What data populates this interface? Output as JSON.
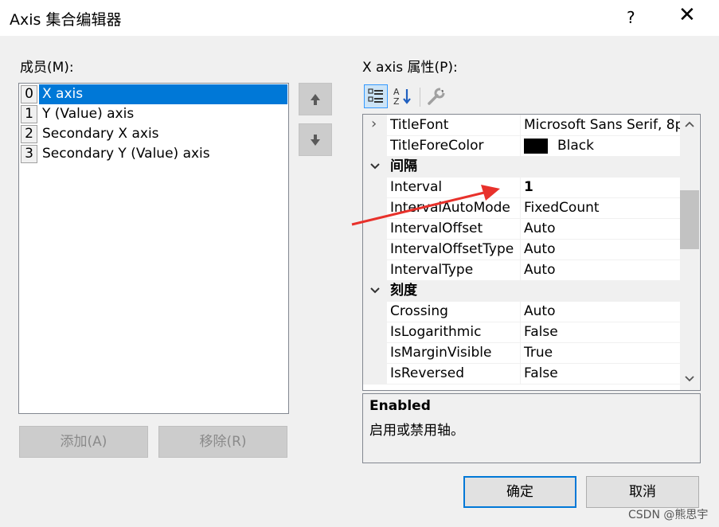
{
  "window": {
    "title": "Axis 集合编辑器",
    "help": "?",
    "close": "✕"
  },
  "members": {
    "label": "成员(M):",
    "items": [
      {
        "index": "0",
        "name": "X axis"
      },
      {
        "index": "1",
        "name": "Y (Value) axis"
      },
      {
        "index": "2",
        "name": "Secondary X axis"
      },
      {
        "index": "3",
        "name": "Secondary Y (Value) axis"
      }
    ],
    "selected_index": 0,
    "add_label": "添加(A)",
    "remove_label": "移除(R)"
  },
  "properties": {
    "label": "X axis 属性(P):",
    "rows": [
      {
        "kind": "prop",
        "expander": "›",
        "name": "TitleFont",
        "value": "Microsoft Sans Serif, 8p"
      },
      {
        "kind": "prop",
        "name": "TitleForeColor",
        "value": "Black",
        "swatch": "#000000"
      },
      {
        "kind": "cat",
        "name": "间隔"
      },
      {
        "kind": "prop",
        "name": "Interval",
        "value": "1",
        "bold": true
      },
      {
        "kind": "prop",
        "name": "IntervalAutoMode",
        "value": "FixedCount"
      },
      {
        "kind": "prop",
        "name": "IntervalOffset",
        "value": "Auto"
      },
      {
        "kind": "prop",
        "name": "IntervalOffsetType",
        "value": "Auto"
      },
      {
        "kind": "prop",
        "name": "IntervalType",
        "value": "Auto"
      },
      {
        "kind": "cat",
        "name": "刻度"
      },
      {
        "kind": "prop",
        "name": "Crossing",
        "value": "Auto"
      },
      {
        "kind": "prop",
        "name": "IsLogarithmic",
        "value": "False"
      },
      {
        "kind": "prop",
        "name": "IsMarginVisible",
        "value": "True"
      },
      {
        "kind": "prop",
        "name": "IsReversed",
        "value": "False"
      }
    ]
  },
  "description": {
    "title": "Enabled",
    "text": "启用或禁用轴。"
  },
  "buttons": {
    "ok": "确定",
    "cancel": "取消"
  },
  "watermark": "CSDN @熊思宇",
  "colors": {
    "accent": "#0078d7",
    "annotation_arrow": "#e8312b"
  }
}
